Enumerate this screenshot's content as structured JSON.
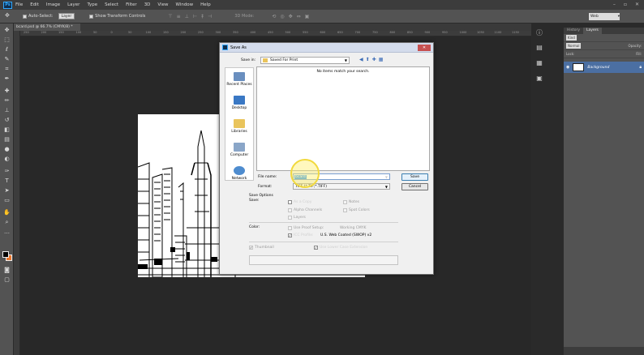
{
  "menubar": {
    "logo": "Ps",
    "items": [
      "File",
      "Edit",
      "Image",
      "Layer",
      "Type",
      "Select",
      "Filter",
      "3D",
      "View",
      "Window",
      "Help"
    ]
  },
  "options": {
    "auto_select_label": "Auto-Select:",
    "auto_select_value": "Layer",
    "transform_label": "Show Transform Controls",
    "mode_3d": "3D Mode:",
    "workspace": "Web"
  },
  "document": {
    "tab": "bcard.psd @ 66.7% (CMYK/8) *",
    "ruler_ticks": [
      "250",
      "200",
      "150",
      "100",
      "50",
      "0",
      "50",
      "100",
      "150",
      "200",
      "250",
      "300",
      "350",
      "400",
      "450",
      "500",
      "550",
      "600",
      "650",
      "700",
      "750",
      "800",
      "850",
      "900",
      "950",
      "1000",
      "1050",
      "1100",
      "1150"
    ]
  },
  "dialog": {
    "title": "Save As",
    "save_in_label": "Save in:",
    "save_in_value": "Saved For Print",
    "empty_message": "No items match your search.",
    "places": [
      "Recent Places",
      "Desktop",
      "Libraries",
      "Computer",
      "Network"
    ],
    "file_name_label": "File name:",
    "file_name_value": "bcard",
    "format_label": "Format:",
    "format_value": "TIFF (*.TIF;*.TIFF)",
    "save_button": "Save",
    "cancel_button": "Cancel",
    "save_options_label": "Save Options",
    "save_label": "Save:",
    "as_copy": "As a Copy",
    "notes": "Notes",
    "alpha_channels": "Alpha Channels",
    "spot_colors": "Spot Colors",
    "layers": "Layers",
    "color_label": "Color:",
    "use_proof": "Use Proof Setup:",
    "proof_value": "Working CMYK",
    "icc_profile": "ICC Profile:",
    "icc_value": "U.S. Web Coated (SWOP) v2",
    "thumbnail": "Thumbnail",
    "lower_case": "Use Lower Case Extension"
  },
  "layers_panel": {
    "tabs": [
      "History",
      "Layers"
    ],
    "kind": "Kind",
    "blend": "Normal",
    "opacity_label": "Opacity:",
    "lock_label": "Lock:",
    "fill_label": "Fill:",
    "layer_name": "Background"
  },
  "colors": {
    "foreground": "#000000",
    "background": "#e8762d",
    "accent": "#31a8ff"
  }
}
